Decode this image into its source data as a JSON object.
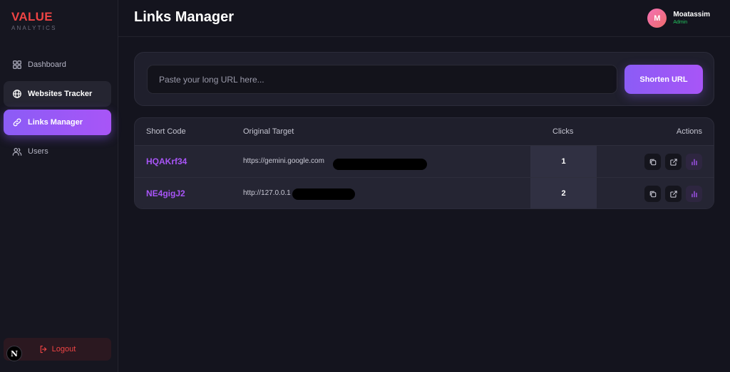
{
  "brand": {
    "title": "VALUE",
    "subtitle": "ANALYTICS"
  },
  "sidebar": {
    "items": [
      {
        "label": "Dashboard",
        "icon": "grid-icon",
        "state": "default"
      },
      {
        "label": "Websites Tracker",
        "icon": "globe-icon",
        "state": "hover"
      },
      {
        "label": "Links Manager",
        "icon": "link-icon",
        "state": "active"
      },
      {
        "label": "Users",
        "icon": "users-icon",
        "state": "default"
      }
    ],
    "logout_label": "Logout",
    "framework_badge": "N"
  },
  "header": {
    "title": "Links Manager",
    "user": {
      "initial": "M",
      "name": "Moatassim",
      "role": "Admin"
    }
  },
  "shortener": {
    "placeholder": "Paste your long URL here...",
    "value": "",
    "button_label": "Shorten URL"
  },
  "table": {
    "headers": {
      "short_code": "Short Code",
      "original_target": "Original Target",
      "clicks": "Clicks",
      "actions": "Actions"
    },
    "rows": [
      {
        "short_code": "HQAKrf34",
        "original_target": "https://gemini.google.com",
        "clicks": "1"
      },
      {
        "short_code": "NE4gigJ2",
        "original_target": "http://127.0.0.1",
        "clicks": "2"
      }
    ],
    "row_actions": [
      "copy-icon",
      "external-link-icon",
      "bar-chart-icon"
    ]
  },
  "colors": {
    "accent": "#8b5cf6",
    "brand": "#ef4444",
    "background": "#14141e",
    "card": "#1f1f2c",
    "status_admin": "#22c55e"
  }
}
